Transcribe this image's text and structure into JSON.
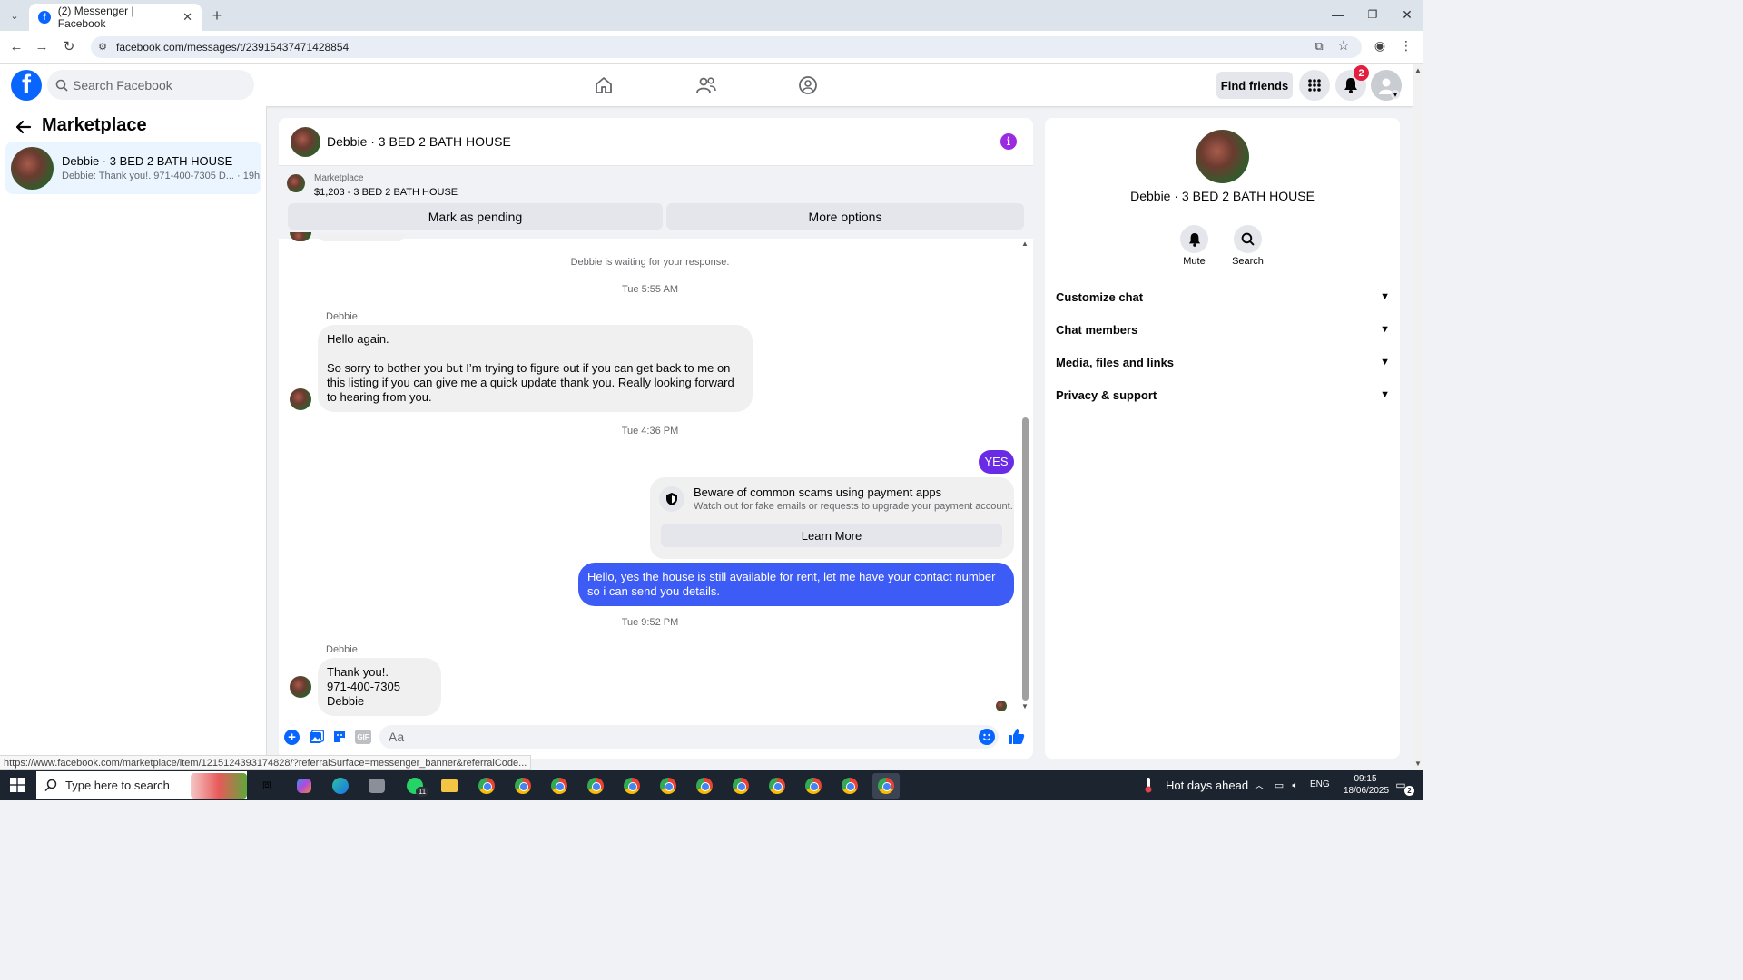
{
  "browser": {
    "tab_title": "(2) Messenger | Facebook",
    "url": "facebook.com/messages/t/23915437471428854",
    "status_url": "https://www.facebook.com/marketplace/item/1215124393174828/?referralSurface=messenger_banner&referralCode..."
  },
  "header": {
    "search_placeholder": "Search Facebook",
    "find_friends": "Find friends",
    "notification_count": "2"
  },
  "left": {
    "title": "Marketplace",
    "conversation": {
      "name": "Debbie · 3 BED 2 BATH HOUSE",
      "preview": "Debbie: Thank you!. 971-400-7305 D... · 19h"
    }
  },
  "chat": {
    "title": "Debbie · 3 BED 2 BATH HOUSE",
    "marketplace_label": "Marketplace",
    "listing": "$1,203 - 3 BED 2 BATH HOUSE",
    "mark_pending": "Mark as pending",
    "more_options": "More options",
    "waiting": "Debbie is waiting for your response.",
    "time1": "Tue 5:55 AM",
    "sender1": "Debbie",
    "msg1_line1": "Hello again.",
    "msg1_body": "So sorry to bother you but I’m trying to figure out if you can get back to me on this listing if you can give me a quick update thank you. Really looking forward to hearing from you.",
    "time2": "Tue 4:36 PM",
    "yes": "YES",
    "scam_title": "Beware of common scams using payment apps",
    "scam_text": "Watch out for fake emails or requests to upgrade your payment account.",
    "learn_more": "Learn More",
    "msg_out": "Hello, yes the house is still available for rent, let me have your contact number so i can send you details.",
    "time3": "Tue 9:52 PM",
    "sender2": "Debbie",
    "msg2_line1": "Thank you!.",
    "msg2_line2": "971-400-7305 Debbie",
    "composer_placeholder": "Aa"
  },
  "right": {
    "name": "Debbie · 3 BED 2 BATH HOUSE",
    "mute": "Mute",
    "search": "Search",
    "sections": [
      "Customize chat",
      "Chat members",
      "Media, files and links",
      "Privacy & support"
    ]
  },
  "taskbar": {
    "search_placeholder": "Type here to search",
    "whatsapp_badge": "11",
    "weather": "Hot days ahead",
    "lang": "ENG",
    "time": "09:15",
    "date": "18/06/2025",
    "notif": "2"
  },
  "colors": {
    "fb_blue": "#0866ff",
    "outgoing_bubble": "#3d5cf5",
    "info_purple": "#9b2be0"
  }
}
